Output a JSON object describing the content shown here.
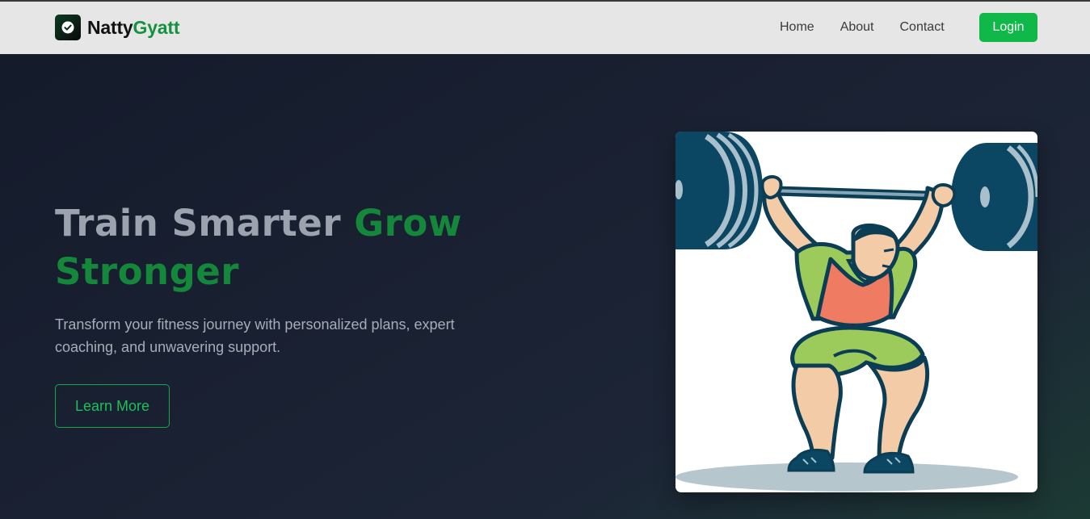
{
  "brand": {
    "name_part1": "Natty",
    "name_part2": "Gyatt",
    "logo_icon": "shield-check-icon"
  },
  "nav": {
    "links": [
      {
        "label": "Home"
      },
      {
        "label": "About"
      },
      {
        "label": "Contact"
      }
    ],
    "login_label": "Login"
  },
  "hero": {
    "title_part1": "Train Smarter ",
    "title_part2": "Grow Stronger",
    "subtitle": "Transform your fitness journey with personalized plans, expert coaching, and unwavering support.",
    "cta_label": "Learn More",
    "image_subject": "weightlifter-illustration"
  },
  "colors": {
    "accent_green": "#0fb848",
    "title_green": "#15873b",
    "title_gray": "#9ca3af",
    "hero_bg": "#1a2132",
    "navbar_bg": "#e6e6e6"
  }
}
